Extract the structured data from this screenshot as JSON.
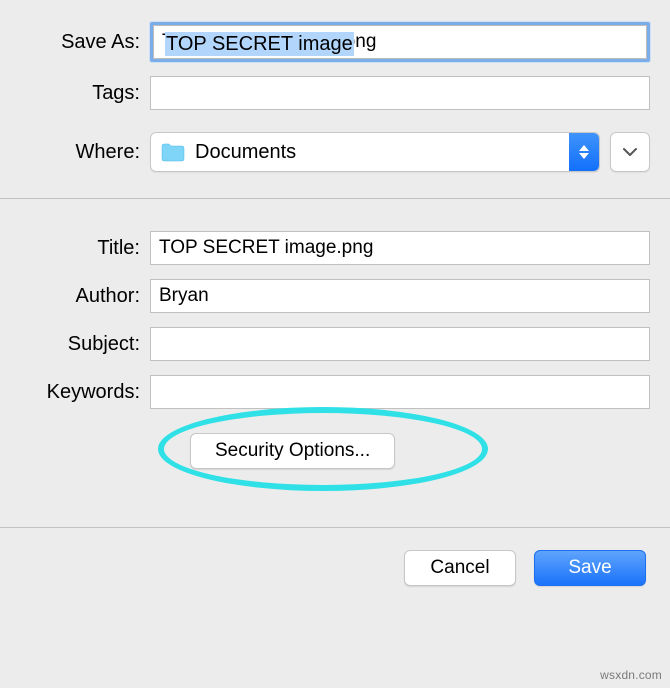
{
  "labels": {
    "save_as": "Save As:",
    "tags": "Tags:",
    "where": "Where:",
    "title": "Title:",
    "author": "Author:",
    "subject": "Subject:",
    "keywords": "Keywords:"
  },
  "fields": {
    "save_as": "TOP SECRET image.png",
    "save_as_selected": "TOP SECRET image",
    "tags": "",
    "where_selected": "Documents",
    "title": "TOP SECRET image.png",
    "author": "Bryan",
    "subject": "",
    "keywords": ""
  },
  "buttons": {
    "security_options": "Security Options...",
    "cancel": "Cancel",
    "save": "Save"
  },
  "watermark": "wsxdn.com"
}
